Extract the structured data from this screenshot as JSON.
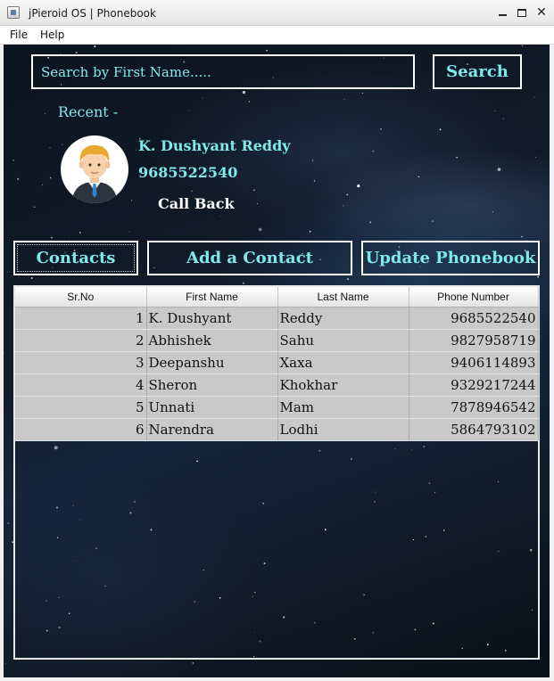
{
  "window": {
    "title": "jPieroid OS | Phonebook",
    "icons": {
      "app": "app-window-icon",
      "minimize": "minimize-icon",
      "maximize": "maximize-icon",
      "close": "close-icon"
    },
    "close_glyph": "✕"
  },
  "menu": {
    "items": [
      "File",
      "Help"
    ]
  },
  "search": {
    "placeholder": "Search by First Name.....",
    "value": "",
    "button_label": "Search"
  },
  "recent": {
    "label": "Recent -",
    "name": "K. Dushyant Reddy",
    "phone": "9685522540",
    "callback_label": "Call Back",
    "avatar_icon": "person-avatar-icon"
  },
  "tabs": {
    "contacts": "Contacts",
    "add": "Add a Contact",
    "update": "Update Phonebook",
    "selected": "Contacts"
  },
  "table": {
    "columns": [
      "Sr.No",
      "First Name",
      "Last Name",
      "Phone Number"
    ],
    "rows": [
      [
        "1",
        "K. Dushyant",
        "Reddy",
        "9685522540"
      ],
      [
        "2",
        "Abhishek",
        "Sahu",
        "9827958719"
      ],
      [
        "3",
        "Deepanshu",
        "Xaxa",
        "9406114893"
      ],
      [
        "4",
        "Sheron",
        "Khokhar",
        "9329217244"
      ],
      [
        "5",
        "Unnati",
        "Mam",
        "7878946542"
      ],
      [
        "6",
        "Narendra",
        "Lodhi",
        "5864793102"
      ]
    ]
  },
  "colors": {
    "accent_text": "#7fe9ea",
    "border": "#ffffff",
    "background": "#0c1420",
    "table_cell": "#c9c9c9"
  }
}
